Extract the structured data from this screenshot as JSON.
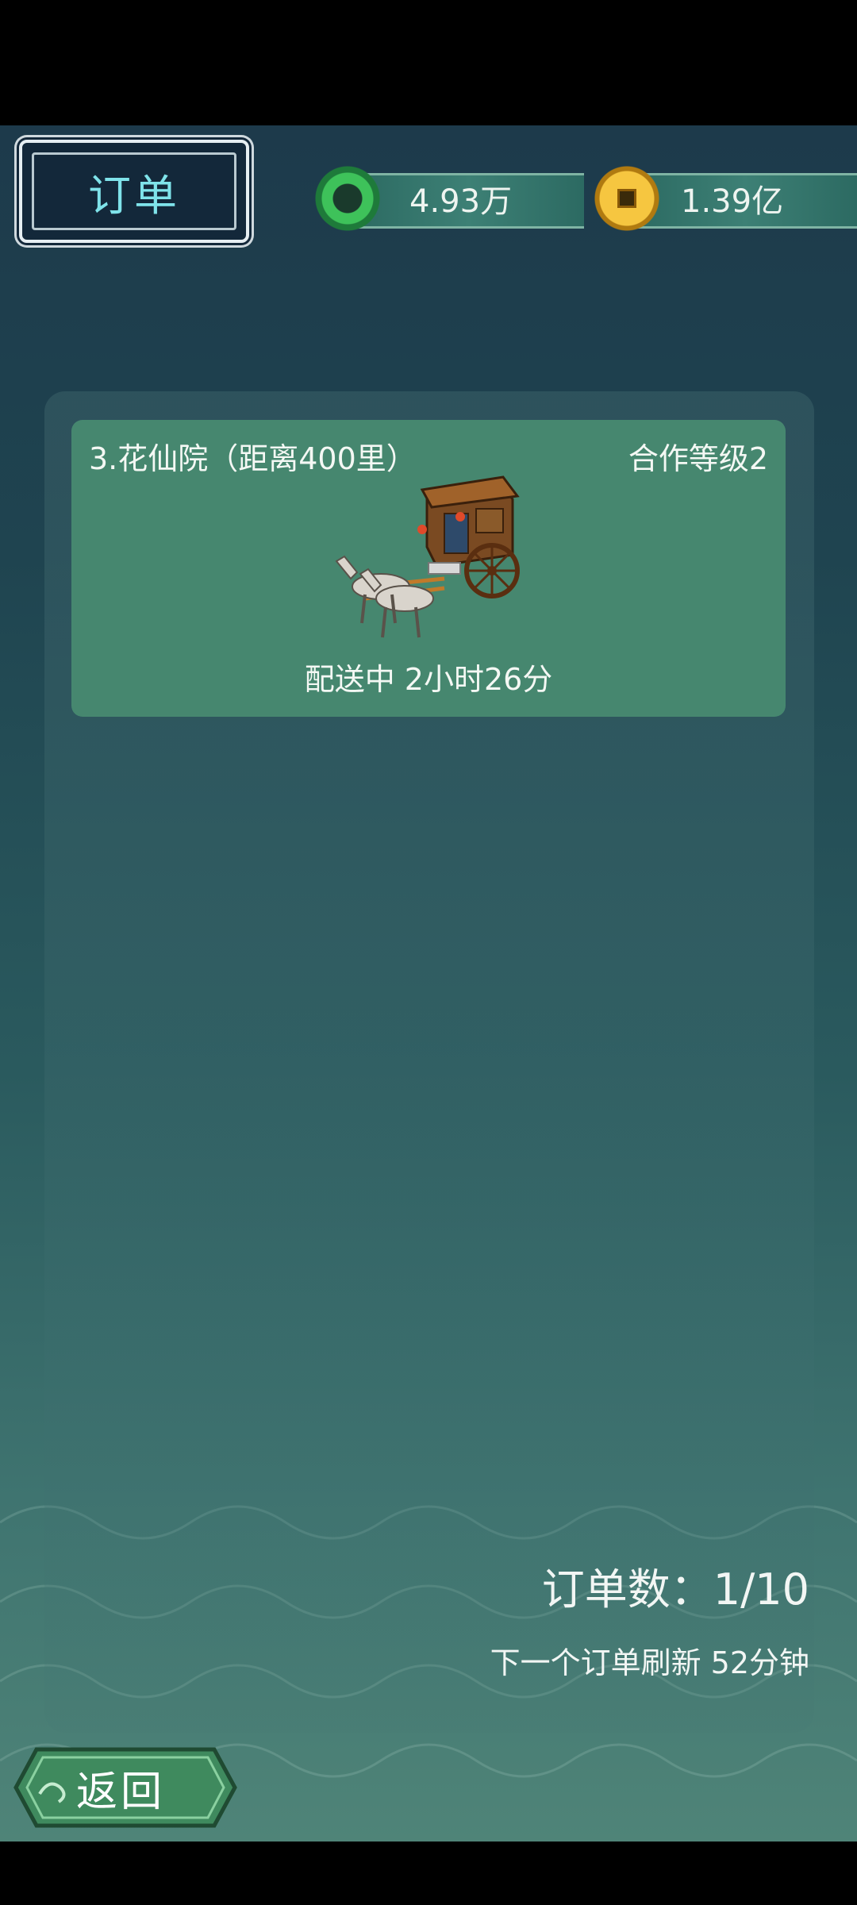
{
  "header": {
    "title": "订单",
    "jade_amount": "4.93万",
    "coin_amount": "1.39亿"
  },
  "order": {
    "title": "3.花仙院（距离400里）",
    "level": "合作等级2",
    "status": "配送中 2小时26分"
  },
  "footer": {
    "order_count": "订单数：1/10",
    "refresh": "下一个订单刷新 52分钟",
    "back_label": "返回"
  },
  "colors": {
    "card_bg": "#46876f",
    "title_text": "#7fe3ea"
  }
}
